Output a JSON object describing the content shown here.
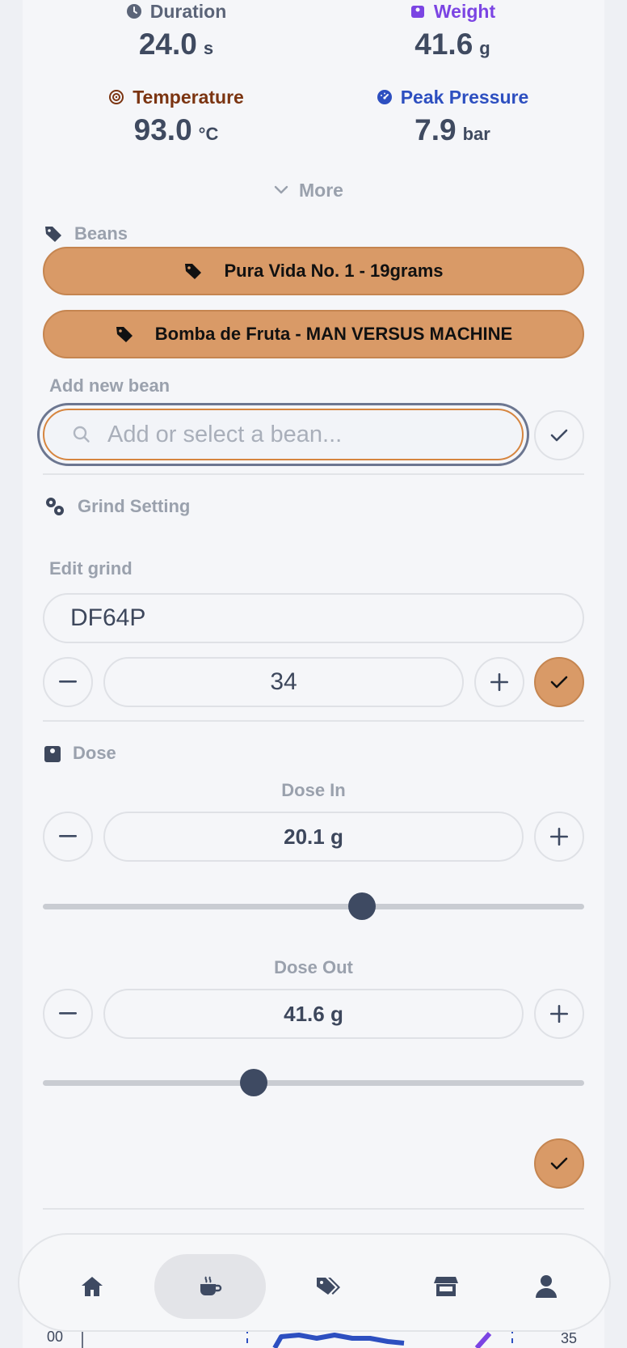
{
  "stats": {
    "duration": {
      "label": "Duration",
      "value": "24.0",
      "unit": "s",
      "color": "#3d475c"
    },
    "weight": {
      "label": "Weight",
      "value": "41.6",
      "unit": "g",
      "color": "#7b44e3"
    },
    "temperature": {
      "label": "Temperature",
      "value": "93.0",
      "unit": "°C",
      "color": "#7b3411"
    },
    "peak_pressure": {
      "label": "Peak Pressure",
      "value": "7.9",
      "unit": "bar",
      "color": "#2d4fc0"
    }
  },
  "more_label": "More",
  "beans": {
    "section_label": "Beans",
    "selected": [
      "Pura Vida No. 1 - 19grams",
      "Bomba de Fruta - MAN VERSUS MACHINE"
    ],
    "add_label": "Add new bean",
    "search_placeholder": "Add or select a bean..."
  },
  "grind": {
    "section_label": "Grind Setting",
    "edit_label": "Edit grind",
    "grinder": "DF64P",
    "value": "34"
  },
  "dose": {
    "section_label": "Dose",
    "dose_in_label": "Dose In",
    "dose_in_value": "20.1 g",
    "dose_in_fraction": 0.59,
    "dose_out_label": "Dose Out",
    "dose_out_value": "41.6 g",
    "dose_out_fraction": 0.39
  },
  "chart_peek": {
    "left_tick": "00",
    "right_tick": "35"
  },
  "nav": {
    "items": [
      "home",
      "brew",
      "beans",
      "store",
      "profile"
    ],
    "active": "brew"
  },
  "colors": {
    "accent": "#d99a67",
    "dark": "#3e4a62",
    "muted": "#9aa1ad"
  }
}
